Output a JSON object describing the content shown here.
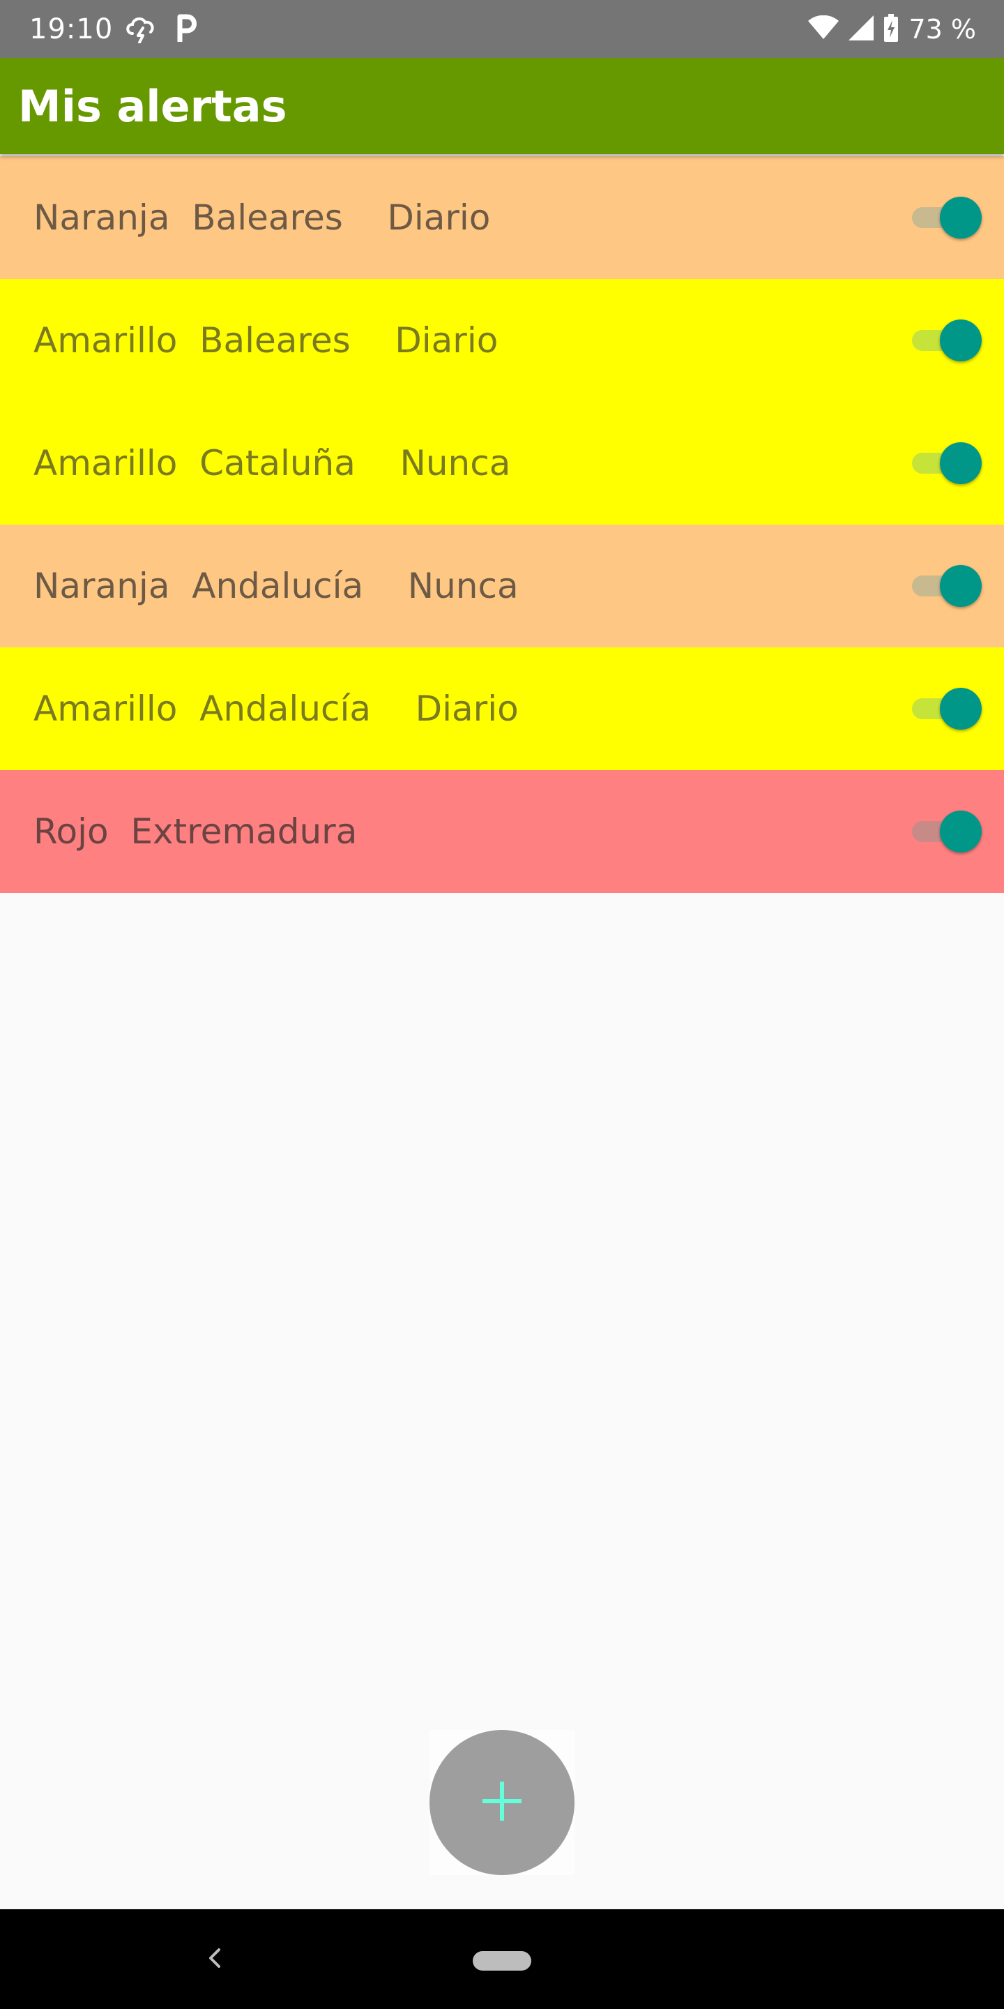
{
  "status_bar": {
    "time": "19:10",
    "battery": "73 %",
    "icons": [
      "thunderstorm-cloud-icon",
      "parking-icon",
      "wifi-icon",
      "cell-signal-icon",
      "battery-charging-icon"
    ]
  },
  "app_bar": {
    "title": "Mis alertas",
    "color": "#669900"
  },
  "alerts": [
    {
      "text": "Naranja  Baleares    Diario",
      "enabled": true,
      "background": "#ffc784",
      "text_color": "#6d5a45",
      "track_color": "#c8b98f"
    },
    {
      "text": "Amarillo  Baleares    Diario",
      "enabled": true,
      "background": "#ffff00",
      "text_color": "#7a7a21",
      "track_color": "#c6e33a"
    },
    {
      "text": "Amarillo  Cataluña    Nunca",
      "enabled": true,
      "background": "#ffff00",
      "text_color": "#7a7a21",
      "track_color": "#c6e33a"
    },
    {
      "text": "Naranja  Andalucía    Nunca",
      "enabled": true,
      "background": "#ffc784",
      "text_color": "#6d5a45",
      "track_color": "#c8b98f"
    },
    {
      "text": "Amarillo  Andalucía    Diario",
      "enabled": true,
      "background": "#ffff00",
      "text_color": "#7a7a21",
      "track_color": "#c6e33a"
    },
    {
      "text": "Rojo  Extremadura",
      "enabled": true,
      "background": "#ff8080",
      "text_color": "#6b4343",
      "track_color": "#c88a86"
    }
  ],
  "fab": {
    "icon": "plus-icon",
    "color": "#9e9e9e",
    "icon_color": "#64ffda"
  },
  "nav_bar": {
    "icons": [
      "back-icon",
      "home-pill-icon"
    ]
  }
}
